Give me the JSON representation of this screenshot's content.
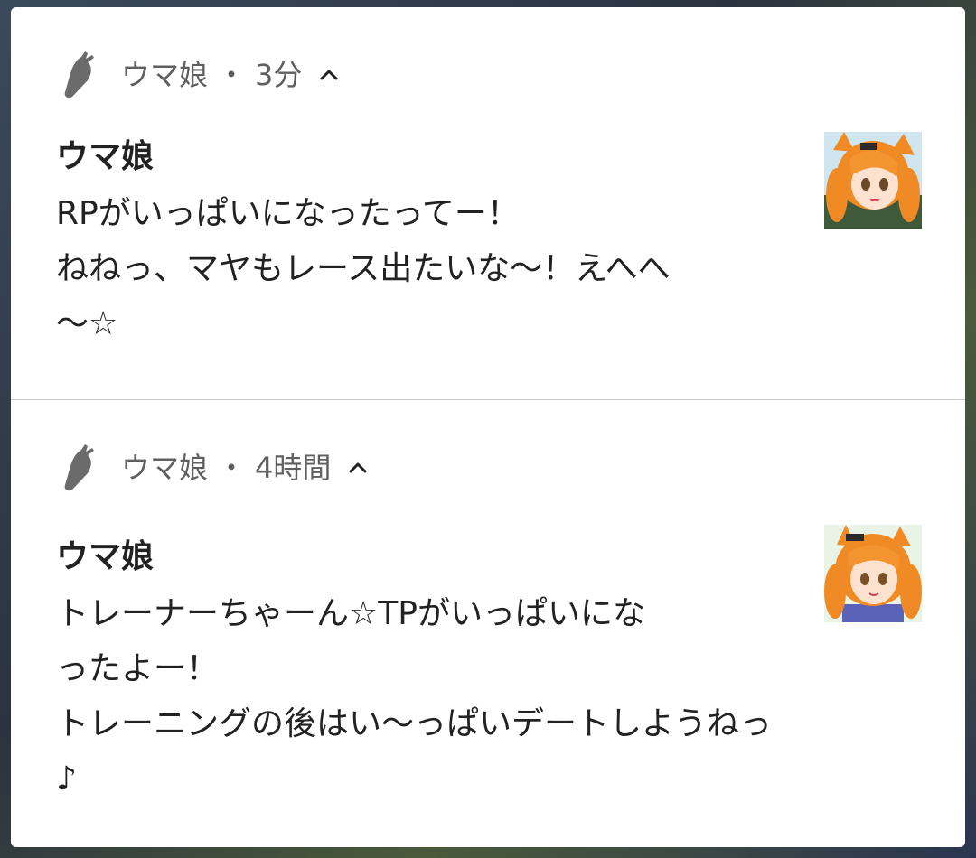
{
  "notifications": [
    {
      "app_name": "ウマ娘",
      "separator": "・",
      "time": "3分",
      "title": "ウマ娘",
      "body": "RPがいっぱいになったってー！\nねねっ、マヤもレース出たいな〜！えへへ\n〜☆",
      "app_icon": "carrot-icon",
      "expand_icon": "chevron-up-icon",
      "thumbnail": "character-avatar"
    },
    {
      "app_name": "ウマ娘",
      "separator": "・",
      "time": "4時間",
      "title": "ウマ娘",
      "body": "トレーナーちゃーん☆TPがいっぱいにな\nったよー！\nトレーニングの後はい〜っぱいデートしようねっ\n♪",
      "app_icon": "carrot-icon",
      "expand_icon": "chevron-up-icon",
      "thumbnail": "character-avatar"
    }
  ],
  "colors": {
    "panel_background": "#ffffff",
    "text_primary": "#222222",
    "text_secondary": "#5f5f5f",
    "icon_gray": "#6b6b6b",
    "divider": "#cfcfcf",
    "hair_orange": "#f08a24"
  }
}
